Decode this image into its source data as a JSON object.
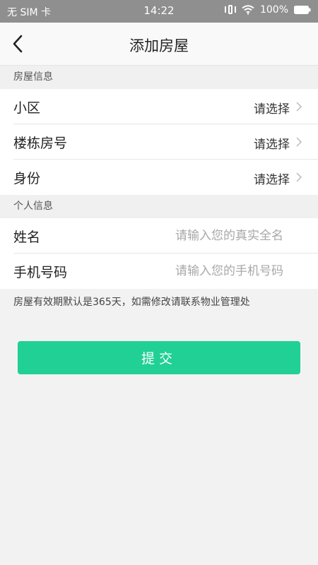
{
  "status_bar": {
    "carrier": "无 SIM 卡",
    "time": "14:22",
    "battery": "100%"
  },
  "nav": {
    "title": "添加房屋"
  },
  "sections": {
    "house_info": {
      "header": "房屋信息",
      "rows": [
        {
          "label": "小区",
          "value": "请选择"
        },
        {
          "label": "楼栋房号",
          "value": "请选择"
        },
        {
          "label": "身份",
          "value": "请选择"
        }
      ]
    },
    "personal_info": {
      "header": "个人信息",
      "fields": [
        {
          "label": "姓名",
          "placeholder": "请输入您的真实全名"
        },
        {
          "label": "手机号码",
          "placeholder": "请输入您的手机号码"
        }
      ]
    }
  },
  "note": "房屋有效期默认是365天，如需修改请联系物业管理处",
  "submit_label": "提交",
  "colors": {
    "accent": "#21d094",
    "status_bar": "#8f8f8f",
    "background": "#f2f2f2"
  }
}
